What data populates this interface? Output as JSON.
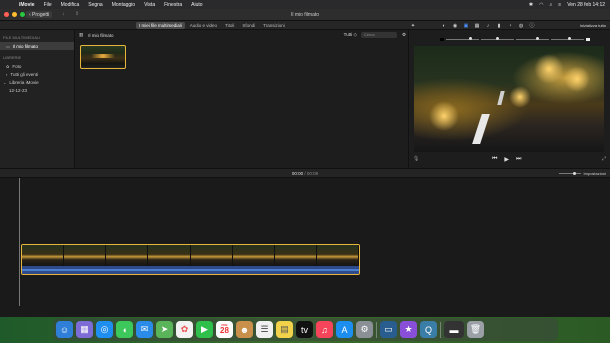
{
  "menubar": {
    "items": [
      "iMovie",
      "File",
      "Modifica",
      "Segna",
      "Montaggio",
      "Vista",
      "Finestra",
      "Aiuto"
    ],
    "datetime": "Ven 28 feb  14:12"
  },
  "window": {
    "title": "Il mio filmato",
    "projects_label": "‹ Progetti"
  },
  "tabs": [
    {
      "label": "I miei file multimediali",
      "active": true
    },
    {
      "label": "Audio e video",
      "active": false
    },
    {
      "label": "Titoli",
      "active": false
    },
    {
      "label": "Sfondi",
      "active": false
    },
    {
      "label": "Transizioni",
      "active": false
    }
  ],
  "tools": {
    "reset_label": "Inizializza tutto"
  },
  "sidebar": {
    "section1": "FILE MULTIMEDIALI",
    "project_item": "Il mio filmato",
    "section2": "LIBRERIE",
    "library_items": [
      {
        "label": "Foto",
        "icon": "photos-icon"
      },
      {
        "label": "Tutti gli eventi",
        "icon": "events-icon"
      }
    ],
    "library_name": "Libreria iMovie",
    "event": "12-12-23"
  },
  "browser": {
    "title": "Il mio filmato",
    "filter": "Tutti ◇",
    "search_placeholder": "Cerca"
  },
  "timeline": {
    "timecode_current": "00:00",
    "timecode_total": "/ 00:08",
    "settings_label": "Impostazioni"
  },
  "dock": {
    "calendar_month": "FEB",
    "calendar_day": "28"
  }
}
